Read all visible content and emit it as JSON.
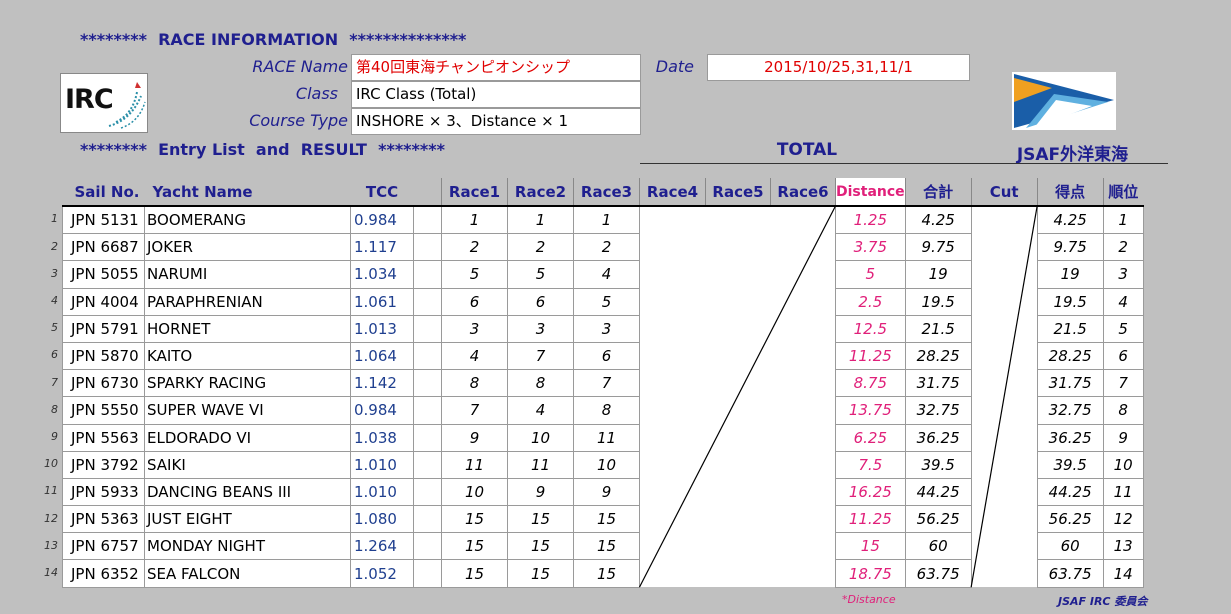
{
  "header": {
    "race_info": "********  RACE INFORMATION  **************",
    "entry_result": "********  Entry List  and  RESULT  ********",
    "total": "TOTAL",
    "org": "JSAF外洋東海"
  },
  "info": {
    "race_name_label": "RACE Name",
    "race_name": "第40回東海チャンピオンシップ",
    "class_label": "Class",
    "class_value": "IRC   Class (Total)",
    "course_label": "Course Type",
    "course_value": "INSHORE × 3、Distance × 1",
    "date_label": "Date",
    "date_value": "2015/10/25,31,11/1"
  },
  "logos": {
    "irc": "IRC"
  },
  "colors": {
    "background": "#c0c0c0",
    "header_blue": "#1f1f8f",
    "distance_pink": "#e0207a",
    "red": "#e00000"
  },
  "columns": [
    "Sail No.",
    "Yacht Name",
    "TCC",
    "Race1",
    "Race2",
    "Race3",
    "Race4",
    "Race5",
    "Race6",
    "Distance",
    "合計",
    "Cut",
    "得点",
    "順位"
  ],
  "rows": [
    {
      "n": "1",
      "sail": "JPN 5131",
      "name": "BOOMERANG",
      "tcc": "0.984",
      "r1": "1",
      "r2": "1",
      "r3": "1",
      "dist": "1.25",
      "total": "4.25",
      "score": "4.25",
      "rank": "1"
    },
    {
      "n": "2",
      "sail": "JPN 6687",
      "name": "JOKER",
      "tcc": "1.117",
      "r1": "2",
      "r2": "2",
      "r3": "2",
      "dist": "3.75",
      "total": "9.75",
      "score": "9.75",
      "rank": "2"
    },
    {
      "n": "3",
      "sail": "JPN 5055",
      "name": "NARUMI",
      "tcc": "1.034",
      "r1": "5",
      "r2": "5",
      "r3": "4",
      "dist": "5",
      "total": "19",
      "score": "19",
      "rank": "3"
    },
    {
      "n": "4",
      "sail": "JPN 4004",
      "name": "PARAPHRENIAN",
      "tcc": "1.061",
      "r1": "6",
      "r2": "6",
      "r3": "5",
      "dist": "2.5",
      "total": "19.5",
      "score": "19.5",
      "rank": "4"
    },
    {
      "n": "5",
      "sail": "JPN 5791",
      "name": "HORNET",
      "tcc": "1.013",
      "r1": "3",
      "r2": "3",
      "r3": "3",
      "dist": "12.5",
      "total": "21.5",
      "score": "21.5",
      "rank": "5"
    },
    {
      "n": "6",
      "sail": "JPN 5870",
      "name": "KAITO",
      "tcc": "1.064",
      "r1": "4",
      "r2": "7",
      "r3": "6",
      "dist": "11.25",
      "total": "28.25",
      "score": "28.25",
      "rank": "6"
    },
    {
      "n": "7",
      "sail": "JPN 6730",
      "name": "SPARKY RACING",
      "tcc": "1.142",
      "r1": "8",
      "r2": "8",
      "r3": "7",
      "dist": "8.75",
      "total": "31.75",
      "score": "31.75",
      "rank": "7"
    },
    {
      "n": "8",
      "sail": "JPN 5550",
      "name": "SUPER WAVE VI",
      "tcc": "0.984",
      "r1": "7",
      "r2": "4",
      "r3": "8",
      "dist": "13.75",
      "total": "32.75",
      "score": "32.75",
      "rank": "8"
    },
    {
      "n": "9",
      "sail": "JPN 5563",
      "name": "ELDORADO VI",
      "tcc": "1.038",
      "r1": "9",
      "r2": "10",
      "r3": "11",
      "dist": "6.25",
      "total": "36.25",
      "score": "36.25",
      "rank": "9"
    },
    {
      "n": "10",
      "sail": "JPN 3792",
      "name": "SAIKI",
      "tcc": "1.010",
      "r1": "11",
      "r2": "11",
      "r3": "10",
      "dist": "7.5",
      "total": "39.5",
      "score": "39.5",
      "rank": "10"
    },
    {
      "n": "11",
      "sail": "JPN 5933",
      "name": "DANCING BEANS III",
      "tcc": "1.010",
      "r1": "10",
      "r2": "9",
      "r3": "9",
      "dist": "16.25",
      "total": "44.25",
      "score": "44.25",
      "rank": "11"
    },
    {
      "n": "12",
      "sail": "JPN 5363",
      "name": "JUST EIGHT",
      "tcc": "1.080",
      "r1": "15",
      "r2": "15",
      "r3": "15",
      "dist": "11.25",
      "total": "56.25",
      "score": "56.25",
      "rank": "12"
    },
    {
      "n": "13",
      "sail": "JPN 6757",
      "name": "MONDAY NIGHT",
      "tcc": "1.264",
      "r1": "15",
      "r2": "15",
      "r3": "15",
      "dist": "15",
      "total": "60",
      "score": "60",
      "rank": "13"
    },
    {
      "n": "14",
      "sail": "JPN 6352",
      "name": "SEA FALCON",
      "tcc": "1.052",
      "r1": "15",
      "r2": "15",
      "r3": "15",
      "dist": "18.75",
      "total": "63.75",
      "score": "63.75",
      "rank": "14"
    }
  ],
  "footer": {
    "distance_note": "*Distance",
    "committee": "JSAF IRC 委員会"
  }
}
